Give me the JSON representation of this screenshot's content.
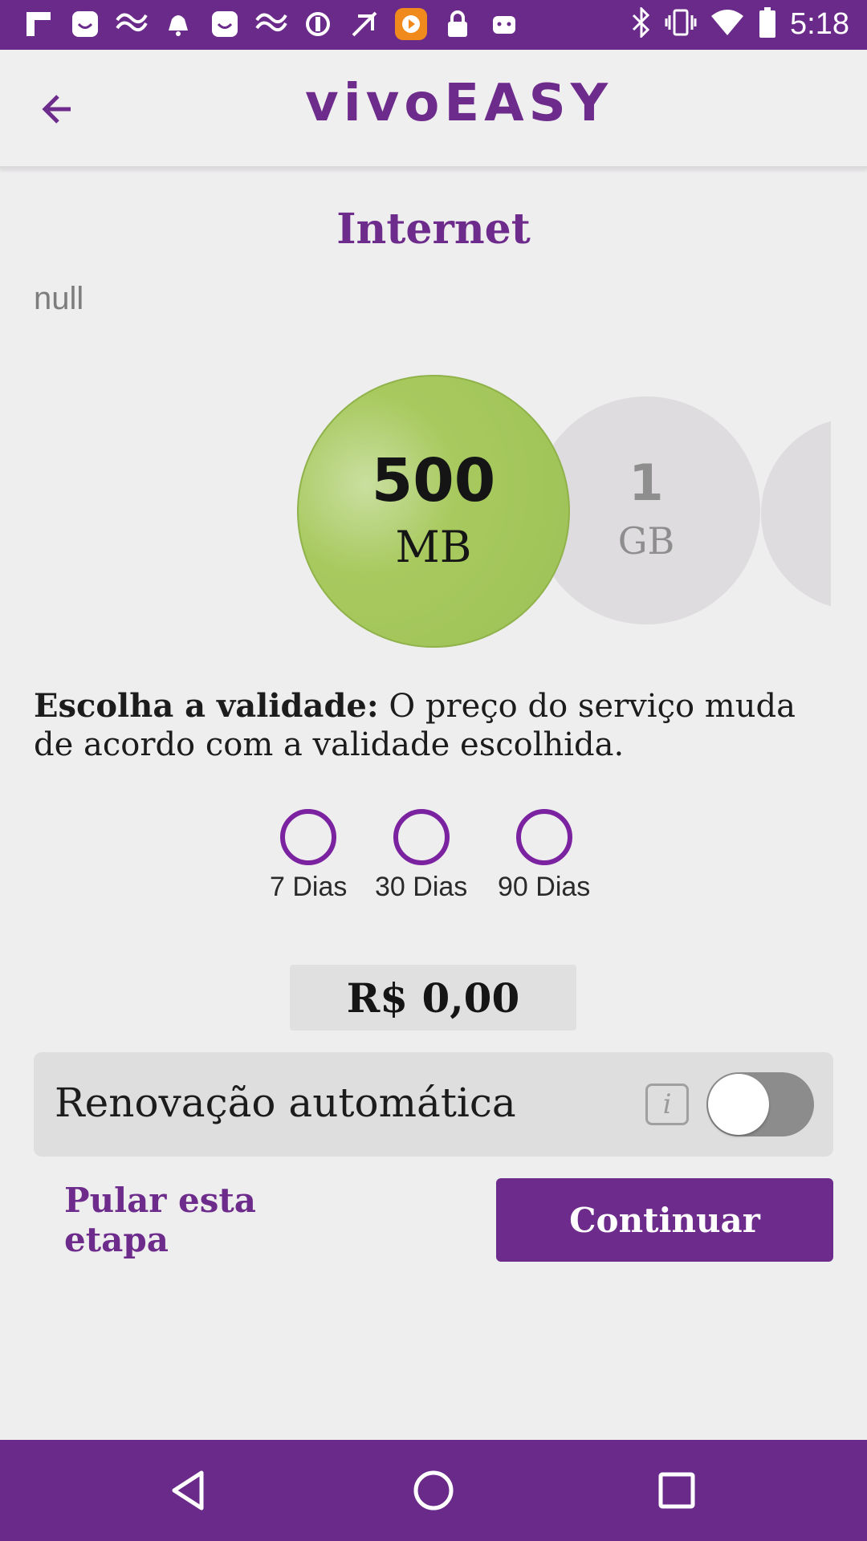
{
  "status_bar": {
    "time": "5:18",
    "left_icons": [
      "flipboard-icon",
      "app-smile-icon",
      "app-wave-icon",
      "notification-bell-icon",
      "app-smile-icon",
      "app-wave-icon",
      "sync-icon",
      "no-signal-icon",
      "app-orange-icon",
      "lock-icon",
      "android-icon"
    ],
    "right_icons": [
      "bluetooth-icon",
      "vibrate-icon",
      "wifi-icon",
      "battery-icon"
    ]
  },
  "header": {
    "logo": "vivoEASY"
  },
  "page": {
    "title": "Internet",
    "subtitle": "null"
  },
  "plans": [
    {
      "amount": "500",
      "unit": "MB",
      "selected": true
    },
    {
      "amount": "1",
      "unit": "GB",
      "selected": false
    },
    {
      "amount": "",
      "unit": "",
      "selected": false
    }
  ],
  "validity": {
    "lead": "Escolha a validade:",
    "text": " O preço do serviço muda de acordo com a validade escolhida."
  },
  "validity_options": [
    {
      "label": "7 Dias",
      "selected": false
    },
    {
      "label": "30 Dias",
      "selected": false
    },
    {
      "label": "90 Dias",
      "selected": false
    }
  ],
  "price": "R$ 0,00",
  "auto_renew": {
    "label": "Renovação automática",
    "info": "i",
    "enabled": false
  },
  "actions": {
    "skip": "Pular esta etapa",
    "continue": "Continuar"
  },
  "colors": {
    "brand_purple": "#6d2b8b",
    "selected_green": "#9dc257"
  }
}
